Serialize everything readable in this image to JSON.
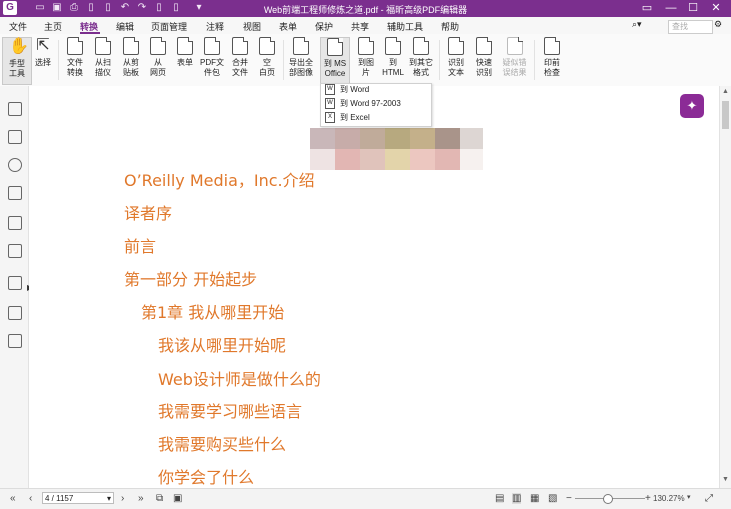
{
  "window": {
    "title": "Web前端工程师修炼之道.pdf - 福昕高级PDF编辑器",
    "controls": [
      "minimize",
      "maximize",
      "close"
    ]
  },
  "menu": {
    "items": [
      "文件",
      "主页",
      "转换",
      "编辑",
      "页面管理",
      "注释",
      "视图",
      "表单",
      "保护",
      "共享",
      "辅助工具",
      "帮助"
    ],
    "active": "转换",
    "search_placeholder": "查找"
  },
  "ribbon": {
    "buttons": [
      {
        "label": "手型\n工具",
        "icon": "hand-icon"
      },
      {
        "label": "选择",
        "icon": "select-cursor-icon"
      },
      {
        "label": "文件\n转换",
        "icon": "file-convert-icon"
      },
      {
        "label": "从扫\n描仪",
        "icon": "scanner-icon"
      },
      {
        "label": "从剪\n贴板",
        "icon": "clipboard-icon"
      },
      {
        "label": "从\n网页",
        "icon": "webpage-icon"
      },
      {
        "label": "表单",
        "icon": "form-icon"
      },
      {
        "label": "PDF文\n件包",
        "icon": "pdf-package-icon"
      },
      {
        "label": "合并\n文件",
        "icon": "merge-icon"
      },
      {
        "label": "空\n白页",
        "icon": "blank-page-icon"
      },
      {
        "label": "导出全\n部图像",
        "icon": "export-images-icon"
      },
      {
        "label": "到 MS\nOffice",
        "icon": "ms-office-icon"
      },
      {
        "label": "到图\n片",
        "icon": "to-image-icon"
      },
      {
        "label": "到\nHTML",
        "icon": "to-html-icon"
      },
      {
        "label": "到其它\n格式",
        "icon": "other-format-icon"
      },
      {
        "label": "识别\n文本",
        "icon": "ocr-icon"
      },
      {
        "label": "快速\n识别",
        "icon": "quick-ocr-icon"
      },
      {
        "label": "疑似错\n误结果",
        "icon": "suspect-results-icon"
      },
      {
        "label": "印前\n检查",
        "icon": "preflight-icon"
      }
    ],
    "selected": "到 MS\nOffice"
  },
  "dropdown": {
    "items": [
      "到 Word",
      "到 Word 97-2003",
      "到 Excel"
    ]
  },
  "document": {
    "toc": [
      "O’Reilly Media，Inc.介绍",
      "译者序",
      "前言",
      "第一部分 开始起步",
      "第1章 我从哪里开始",
      "我该从哪里开始呢",
      "Web设计师是做什么的",
      "我需要学习哪些语言",
      "我需要购买些什么",
      "你学会了什么"
    ],
    "text_color": "#e0782b"
  },
  "status": {
    "page": "4 / 1157",
    "zoom": "130.27%",
    "zoom_level": 0.45
  },
  "colors": {
    "accent": "#7b2f8e",
    "bulb": "#8b2b96"
  }
}
